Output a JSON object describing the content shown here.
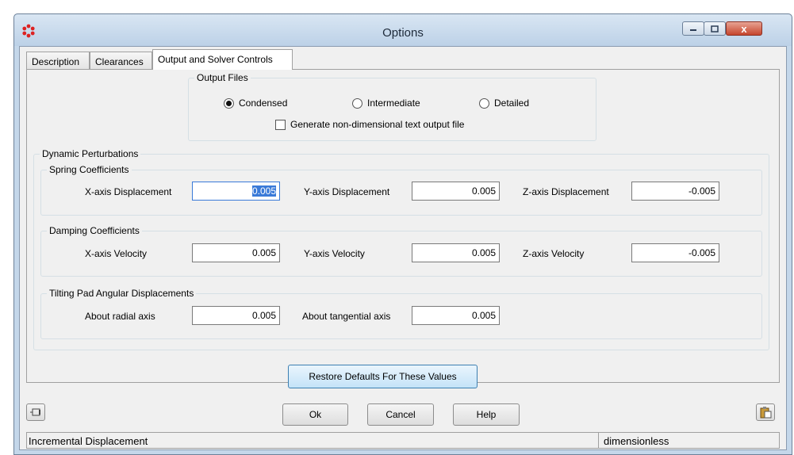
{
  "window": {
    "title": "Options",
    "close_glyph": "x"
  },
  "tabs": [
    {
      "label": "Description"
    },
    {
      "label": "Clearances"
    },
    {
      "label": "Output and Solver Controls"
    }
  ],
  "output_files": {
    "legend": "Output Files",
    "options": [
      {
        "label": "Condensed",
        "selected": true
      },
      {
        "label": "Intermediate",
        "selected": false
      },
      {
        "label": "Detailed",
        "selected": false
      }
    ],
    "checkbox_label": "Generate non-dimensional text output file",
    "checkbox_checked": false
  },
  "dynamic": {
    "legend": "Dynamic Perturbations",
    "spring": {
      "legend": "Spring Coefficients",
      "x_label": "X-axis Displacement",
      "x_value": "0.005",
      "y_label": "Y-axis Displacement",
      "y_value": "0.005",
      "z_label": "Z-axis Displacement",
      "z_value": "-0.005"
    },
    "damping": {
      "legend": "Damping Coefficients",
      "x_label": "X-axis Velocity",
      "x_value": "0.005",
      "y_label": "Y-axis Velocity",
      "y_value": "0.005",
      "z_label": "Z-axis Velocity",
      "z_value": "-0.005"
    },
    "tilting": {
      "legend": "Tilting Pad Angular Displacements",
      "radial_label": "About radial axis",
      "radial_value": "0.005",
      "tangential_label": "About tangential axis",
      "tangential_value": "0.005"
    }
  },
  "buttons": {
    "restore": "Restore Defaults For These Values",
    "ok": "Ok",
    "cancel": "Cancel",
    "help": "Help"
  },
  "status": {
    "left": "Incremental Displacement",
    "right": "dimensionless"
  },
  "colors": {
    "accent": "#3a7ad8",
    "window_frame": "#c4d7ea",
    "close_button": "#c6452d"
  }
}
